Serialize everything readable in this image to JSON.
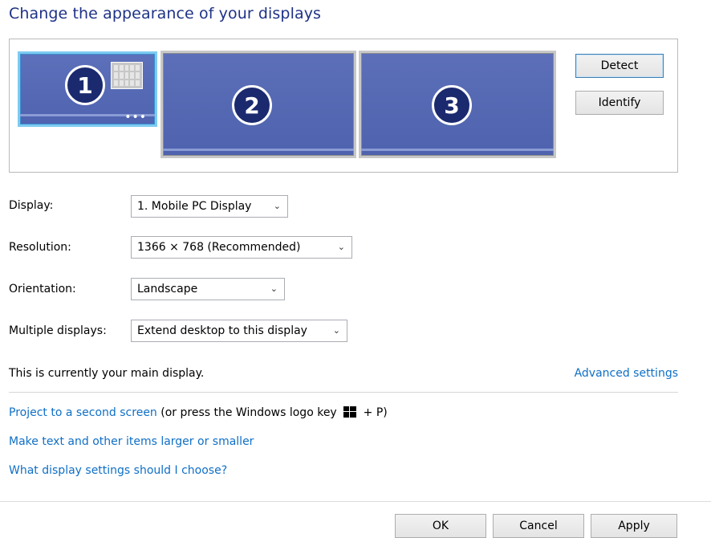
{
  "title": "Change the appearance of your displays",
  "monitors": [
    {
      "number": "1",
      "selected": true
    },
    {
      "number": "2",
      "selected": false
    },
    {
      "number": "3",
      "selected": false
    }
  ],
  "buttons": {
    "detect": "Detect",
    "identify": "Identify",
    "ok": "OK",
    "cancel": "Cancel",
    "apply": "Apply"
  },
  "settings": {
    "display_label": "Display:",
    "display_value": "1. Mobile PC Display",
    "resolution_label": "Resolution:",
    "resolution_value": "1366 × 768 (Recommended)",
    "orientation_label": "Orientation:",
    "orientation_value": "Landscape",
    "multiple_label": "Multiple displays:",
    "multiple_value": "Extend desktop to this display"
  },
  "status": "This is currently your main display.",
  "links": {
    "advanced": "Advanced settings",
    "project": "Project to a second screen",
    "project_suffix_a": "(or press the Windows logo key",
    "project_suffix_b": "+ P)",
    "text_size": "Make text and other items larger or smaller",
    "help": "What display settings should I choose?"
  },
  "icons": {
    "chevron": "chevron-down-icon",
    "windows_key": "windows-logo-icon"
  },
  "colors": {
    "title": "#1e3287",
    "link": "#0f6fc6",
    "monitor": "#5066b0",
    "selected_border": "#7ecbf2"
  }
}
